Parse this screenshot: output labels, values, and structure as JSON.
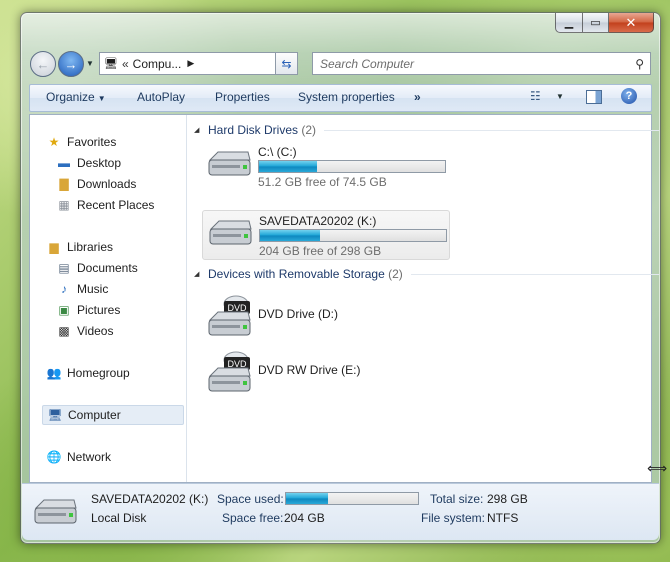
{
  "window": {
    "address_chevron": "«",
    "address_crumb": "Compu...",
    "search_placeholder": "Search Computer"
  },
  "toolbar": {
    "organize": "Organize",
    "autoplay": "AutoPlay",
    "properties": "Properties",
    "system_properties": "System properties",
    "more": "»"
  },
  "nav": {
    "favorites": "Favorites",
    "desktop": "Desktop",
    "downloads": "Downloads",
    "recent_places": "Recent Places",
    "libraries": "Libraries",
    "documents": "Documents",
    "music": "Music",
    "pictures": "Pictures",
    "videos": "Videos",
    "homegroup": "Homegroup",
    "computer": "Computer",
    "network": "Network"
  },
  "groups": {
    "hdd_title": "Hard Disk Drives",
    "hdd_count": "(2)",
    "removable_title": "Devices with Removable Storage",
    "removable_count": "(2)"
  },
  "drives": [
    {
      "name": "C:\\ (C:)",
      "free_text": "51.2 GB free of 74.5 GB",
      "used_fraction": 0.31
    },
    {
      "name": "SAVEDATA20202 (K:)",
      "free_text": "204 GB free of 298 GB",
      "used_fraction": 0.32
    }
  ],
  "removable": [
    {
      "name": "DVD Drive (D:)",
      "badge": "DVD"
    },
    {
      "name": "DVD RW Drive (E:)",
      "badge": "DVD"
    }
  ],
  "status": {
    "drive_name": "SAVEDATA20202 (K:)",
    "drive_type": "Local Disk",
    "space_used_label": "Space used:",
    "space_used_fraction": 0.32,
    "space_free_label": "Space free:",
    "space_free_value": "204 GB",
    "total_size_label": "Total size:",
    "total_size_value": "298 GB",
    "file_system_label": "File system:",
    "file_system_value": "NTFS"
  }
}
